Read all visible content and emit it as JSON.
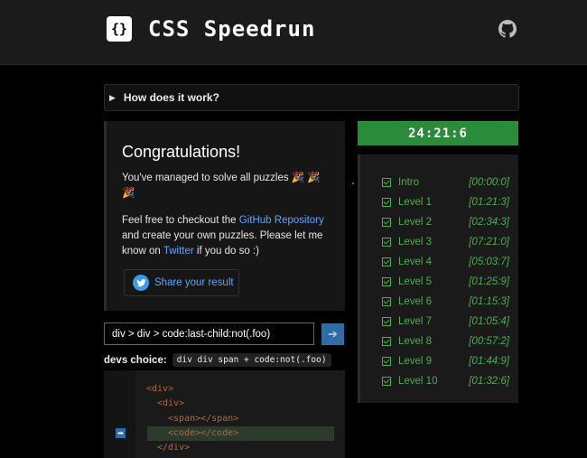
{
  "header": {
    "logo_glyph": "{}",
    "title": "CSS Speedrun",
    "github_icon": "github-icon"
  },
  "details": {
    "label": "How does it work?"
  },
  "congrats": {
    "title": "Congratulations!",
    "line1": "You've managed to solve all puzzles 🎉 🎉 🎉",
    "p2_before": "Feel free to checkout the ",
    "p2_link": "GitHub Repository",
    "p2_middle": " and create your own puzzles. Please let me know on ",
    "p2_link2": "Twitter",
    "p2_after": " if you do so :)",
    "share_label": "Share your result"
  },
  "timer": "24:21:6",
  "levels": [
    {
      "name": "Intro",
      "time": "[00:00:0]"
    },
    {
      "name": "Level 1",
      "time": "[01:21:3]"
    },
    {
      "name": "Level 2",
      "time": "[02:34:3]"
    },
    {
      "name": "Level 3",
      "time": "[07:21:0]"
    },
    {
      "name": "Level 4",
      "time": "[05:03:7]"
    },
    {
      "name": "Level 5",
      "time": "[01:25:9]"
    },
    {
      "name": "Level 6",
      "time": "[01:15:3]"
    },
    {
      "name": "Level 7",
      "time": "[01:05:4]"
    },
    {
      "name": "Level 8",
      "time": "[00:57:2]"
    },
    {
      "name": "Level 9",
      "time": "[01:44:9]"
    },
    {
      "name": "Level 10",
      "time": "[01:32:6]"
    }
  ],
  "selector": {
    "value": "div > div > code:last-child:not(.foo)",
    "submit_glyph": "➔"
  },
  "devs": {
    "label": "devs choice:",
    "code": "div div span + code:not(.foo)"
  },
  "code": {
    "lines": [
      "<div>",
      "<div>",
      "<span></span>",
      "<code></code>",
      "</div>"
    ],
    "marker_glyph": "➡"
  },
  "colors": {
    "accent_green": "#2a8c3a",
    "link_blue": "#5aa6ff",
    "button_blue": "#2f6ca3"
  }
}
